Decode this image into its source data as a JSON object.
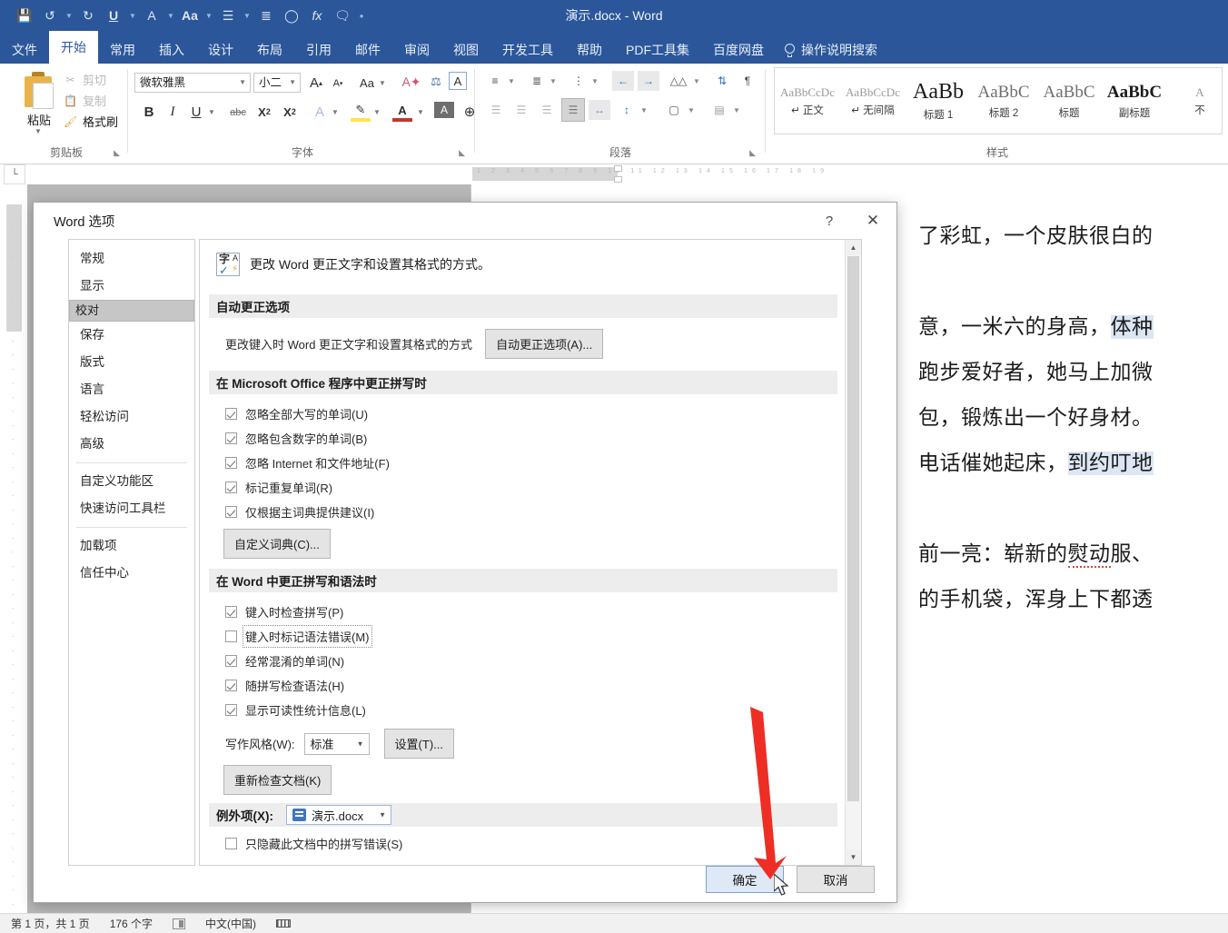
{
  "titlebar": {
    "document_title": "演示.docx  -  Word",
    "qat": [
      {
        "name": "save",
        "glyph": "Ὃe"
      },
      {
        "name": "undo",
        "glyph": "↺"
      },
      {
        "name": "redo",
        "glyph": "↻"
      },
      {
        "name": "underline",
        "glyph": "U"
      },
      {
        "name": "font-color",
        "glyph": "A"
      },
      {
        "name": "change-case",
        "glyph": "Aa"
      },
      {
        "name": "bullets",
        "glyph": "☰"
      },
      {
        "name": "align",
        "glyph": "≣"
      },
      {
        "name": "shape",
        "glyph": "◯"
      },
      {
        "name": "formula",
        "glyph": "fx"
      },
      {
        "name": "comment",
        "glyph": "🗨"
      },
      {
        "name": "more",
        "glyph": "•"
      }
    ]
  },
  "tabs": [
    {
      "label": "文件",
      "active": false
    },
    {
      "label": "开始",
      "active": true
    },
    {
      "label": "常用",
      "active": false
    },
    {
      "label": "插入",
      "active": false
    },
    {
      "label": "设计",
      "active": false
    },
    {
      "label": "布局",
      "active": false
    },
    {
      "label": "引用",
      "active": false
    },
    {
      "label": "邮件",
      "active": false
    },
    {
      "label": "审阅",
      "active": false
    },
    {
      "label": "视图",
      "active": false
    },
    {
      "label": "开发工具",
      "active": false
    },
    {
      "label": "帮助",
      "active": false
    },
    {
      "label": "PDF工具集",
      "active": false
    },
    {
      "label": "百度网盘",
      "active": false
    }
  ],
  "tellme": "操作说明搜索",
  "ribbon": {
    "clipboard": {
      "group_label": "剪贴板",
      "paste_label": "粘贴",
      "cut_label": "剪切",
      "copy_label": "复制",
      "format_painter_label": "格式刷"
    },
    "font": {
      "group_label": "字体",
      "font_name": "微软雅黑",
      "font_size": "小二",
      "grow_label": "A",
      "shrink_label": "A",
      "case_label": "Aa",
      "bold": "B",
      "italic": "I",
      "underline": "U",
      "strikethrough": "abc",
      "subscript": "X₂",
      "superscript": "X²",
      "text_effects": "A",
      "highlight": "ab",
      "font_color": "A",
      "char_shading": "A",
      "enclose": "⊕"
    },
    "paragraph": {
      "group_label": "段落"
    },
    "styles": {
      "group_label": "样式",
      "items": [
        {
          "preview": "AaBbCcDc",
          "name": "正文",
          "kind": "normal"
        },
        {
          "preview": "AaBbCcDc",
          "name": "无间隔",
          "kind": "normal"
        },
        {
          "preview": "AaBb",
          "name": "标题 1",
          "kind": "h1"
        },
        {
          "preview": "AaBbC",
          "name": "标题 2",
          "kind": "h2"
        },
        {
          "preview": "AaBbC",
          "name": "标题",
          "kind": "ti"
        },
        {
          "preview": "AaBbC",
          "name": "副标题",
          "kind": "st"
        },
        {
          "preview": "A",
          "name": "不",
          "kind": "normal"
        }
      ]
    }
  },
  "document": {
    "lines": [
      "了彩虹，一个皮肤很白的",
      "意，一米六的身高，体种",
      "跑步爱好者，她马上加微",
      "包，锻炼出一个好身材。",
      "电话催她起床，到约叮地",
      "前一亮：崭新的熨动服、",
      "的手机袋，浑身上下都透"
    ]
  },
  "dialog": {
    "title": "Word 选项",
    "help_glyph": "?",
    "close_glyph": "✕",
    "nav_groups": [
      {
        "items": [
          "常规",
          "显示",
          "校对",
          "保存",
          "版式",
          "语言",
          "轻松访问",
          "高级"
        ]
      },
      {
        "items": [
          "自定义功能区",
          "快速访问工具栏"
        ]
      },
      {
        "items": [
          "加载项",
          "信任中心"
        ]
      }
    ],
    "selected_nav": "校对",
    "header_text": "更改 Word 更正文字和设置其格式的方式。",
    "section_autocorrect": {
      "title": "自动更正选项",
      "description": "更改键入时 Word 更正文字和设置其格式的方式",
      "button": "自动更正选项(A)..."
    },
    "section_office_spelling": {
      "title": "在 Microsoft Office 程序中更正拼写时",
      "checkboxes": [
        {
          "label": "忽略全部大写的单词(U)",
          "checked": true
        },
        {
          "label": "忽略包含数字的单词(B)",
          "checked": true
        },
        {
          "label": "忽略 Internet 和文件地址(F)",
          "checked": true
        },
        {
          "label": "标记重复单词(R)",
          "checked": true
        },
        {
          "label": "仅根据主词典提供建议(I)",
          "checked": true
        }
      ],
      "button": "自定义词典(C)..."
    },
    "section_word_spelling": {
      "title": "在 Word 中更正拼写和语法时",
      "checkboxes": [
        {
          "label": "键入时检查拼写(P)",
          "checked": true,
          "focused": false
        },
        {
          "label": "键入时标记语法错误(M)",
          "checked": false,
          "focused": true
        },
        {
          "label": "经常混淆的单词(N)",
          "checked": true,
          "focused": false
        },
        {
          "label": "随拼写检查语法(H)",
          "checked": true,
          "focused": false
        },
        {
          "label": "显示可读性统计信息(L)",
          "checked": true,
          "focused": false
        }
      ],
      "writing_style_label": "写作风格(W):",
      "writing_style_value": "标准",
      "settings_button": "设置(T)...",
      "recheck_button": "重新检查文档(K)"
    },
    "section_exceptions": {
      "title": "例外项(X):",
      "document_value": "演示.docx",
      "checkbox": {
        "label": "只隐藏此文档中的拼写错误(S)",
        "checked": false
      }
    },
    "ok_button": "确定",
    "cancel_button": "取消"
  },
  "statusbar": {
    "page_info": "第 1 页，共 1 页",
    "word_count": "176 个字",
    "language": "中文(中国)"
  },
  "colors": {
    "ribbon_blue": "#2b579a",
    "accent_ok": "#7aa2d4",
    "arrow_red": "#ee2e24",
    "selected_nav_bg": "#c6c6c6"
  }
}
